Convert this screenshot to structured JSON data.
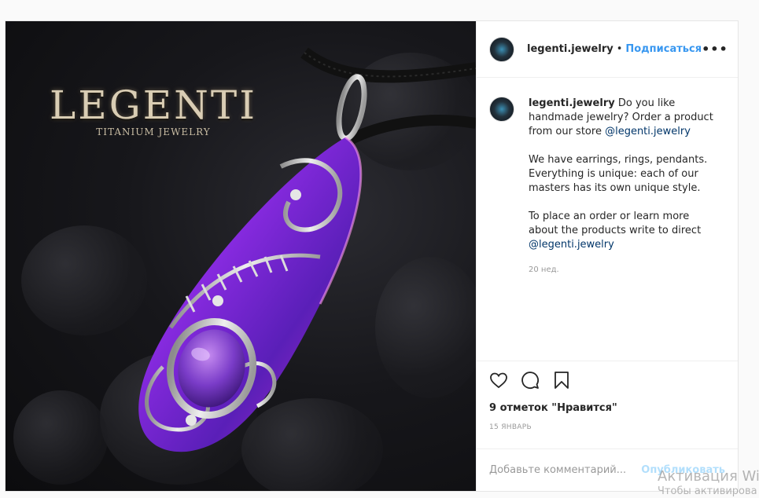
{
  "media": {
    "brand_title": "LEGENTI",
    "brand_subtitle": "TITANIUM JEWELRY"
  },
  "header": {
    "username": "legenti.jewelry",
    "separator": "•",
    "follow_label": "Подписаться",
    "more_label": "•••"
  },
  "caption": {
    "username": "legenti.jewelry",
    "text_1": "Do you like handmade jewelry? Order a product from our store",
    "mention_1": "@legenti.jewelry",
    "text_2": "We have earrings, rings, pendants. Everything is unique: each of our masters has its own unique style.",
    "text_3": "To place an order or learn more about the products write to direct",
    "mention_2": "@legenti.jewelry",
    "time": "20 нед."
  },
  "actions": {
    "icons": [
      "heart-icon",
      "comment-icon",
      "bookmark-icon"
    ],
    "likes": "9 отметок \"Нравится\"",
    "date": "15 ЯНВАРЬ"
  },
  "comment_box": {
    "placeholder": "Добавьте комментарий...",
    "post_label": "Опубликовать"
  },
  "os_watermark": {
    "line_1": "Активация Wi",
    "line_2": "Чтобы активирова"
  },
  "colors": {
    "link": "#3897f0",
    "mention": "#003569",
    "post_disabled": "#b2dffc",
    "muted": "#999999"
  }
}
